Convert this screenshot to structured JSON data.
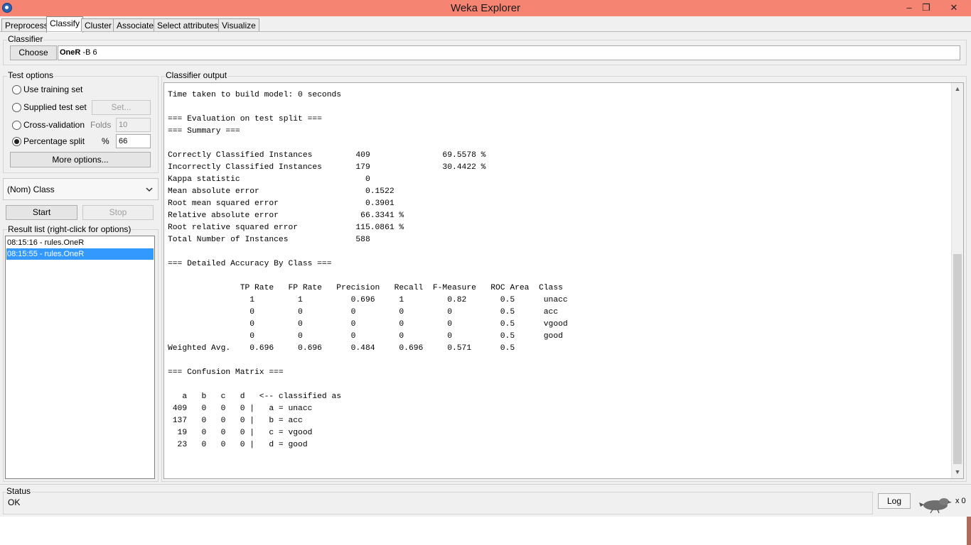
{
  "window": {
    "title": "Weka Explorer",
    "controls": {
      "minimize": "–",
      "maximize": "❒",
      "close": "✕"
    }
  },
  "tabs": [
    {
      "label": "Preprocess",
      "active": false
    },
    {
      "label": "Classify",
      "active": true
    },
    {
      "label": "Cluster",
      "active": false
    },
    {
      "label": "Associate",
      "active": false
    },
    {
      "label": "Select attributes",
      "active": false
    },
    {
      "label": "Visualize",
      "active": false
    }
  ],
  "classifier": {
    "group_label": "Classifier",
    "choose_label": "Choose",
    "name": "OneR",
    "args": " -B 6"
  },
  "test_options": {
    "group_label": "Test options",
    "use_training_set": "Use training set",
    "supplied_test_set": "Supplied test set",
    "set_button": "Set...",
    "cross_validation": "Cross-validation",
    "folds_label": "Folds",
    "folds_value": "10",
    "percentage_split": "Percentage split",
    "percent_label": "%",
    "percent_value": "66",
    "selected": "percentage_split",
    "more_options": "More options..."
  },
  "class_select": {
    "value": "(Nom) Class"
  },
  "run": {
    "start_label": "Start",
    "stop_label": "Stop"
  },
  "result_list": {
    "group_label": "Result list (right-click for options)",
    "items": [
      {
        "label": "08:15:16 - rules.OneR",
        "selected": false
      },
      {
        "label": "08:15:55 - rules.OneR",
        "selected": true
      }
    ]
  },
  "output": {
    "group_label": "Classifier output",
    "lines": [
      "Time taken to build model: 0 seconds",
      "",
      "=== Evaluation on test split ===",
      "=== Summary ===",
      "",
      "Correctly Classified Instances         409               69.5578 %",
      "Incorrectly Classified Instances       179               30.4422 %",
      "Kappa statistic                          0",
      "Mean absolute error                      0.1522",
      "Root mean squared error                  0.3901",
      "Relative absolute error                 66.3341 %",
      "Root relative squared error            115.0861 %",
      "Total Number of Instances              588",
      "",
      "=== Detailed Accuracy By Class ===",
      "",
      "               TP Rate   FP Rate   Precision   Recall  F-Measure   ROC Area  Class",
      "                 1         1          0.696     1         0.82       0.5      unacc",
      "                 0         0          0         0         0          0.5      acc",
      "                 0         0          0         0         0          0.5      vgood",
      "                 0         0          0         0         0          0.5      good",
      "Weighted Avg.    0.696     0.696      0.484     0.696     0.571      0.5",
      "",
      "=== Confusion Matrix ===",
      "",
      "   a   b   c   d   <-- classified as",
      " 409   0   0   0 |   a = unacc",
      " 137   0   0   0 |   b = acc",
      "  19   0   0   0 |   c = vgood",
      "  23   0   0   0 |   d = good"
    ]
  },
  "status": {
    "group_label": "Status",
    "text": "OK",
    "log_label": "Log",
    "count": "x 0"
  },
  "colors": {
    "titlebar": "#f58473",
    "selection": "#3399ff",
    "panel": "#f0f0f0"
  }
}
